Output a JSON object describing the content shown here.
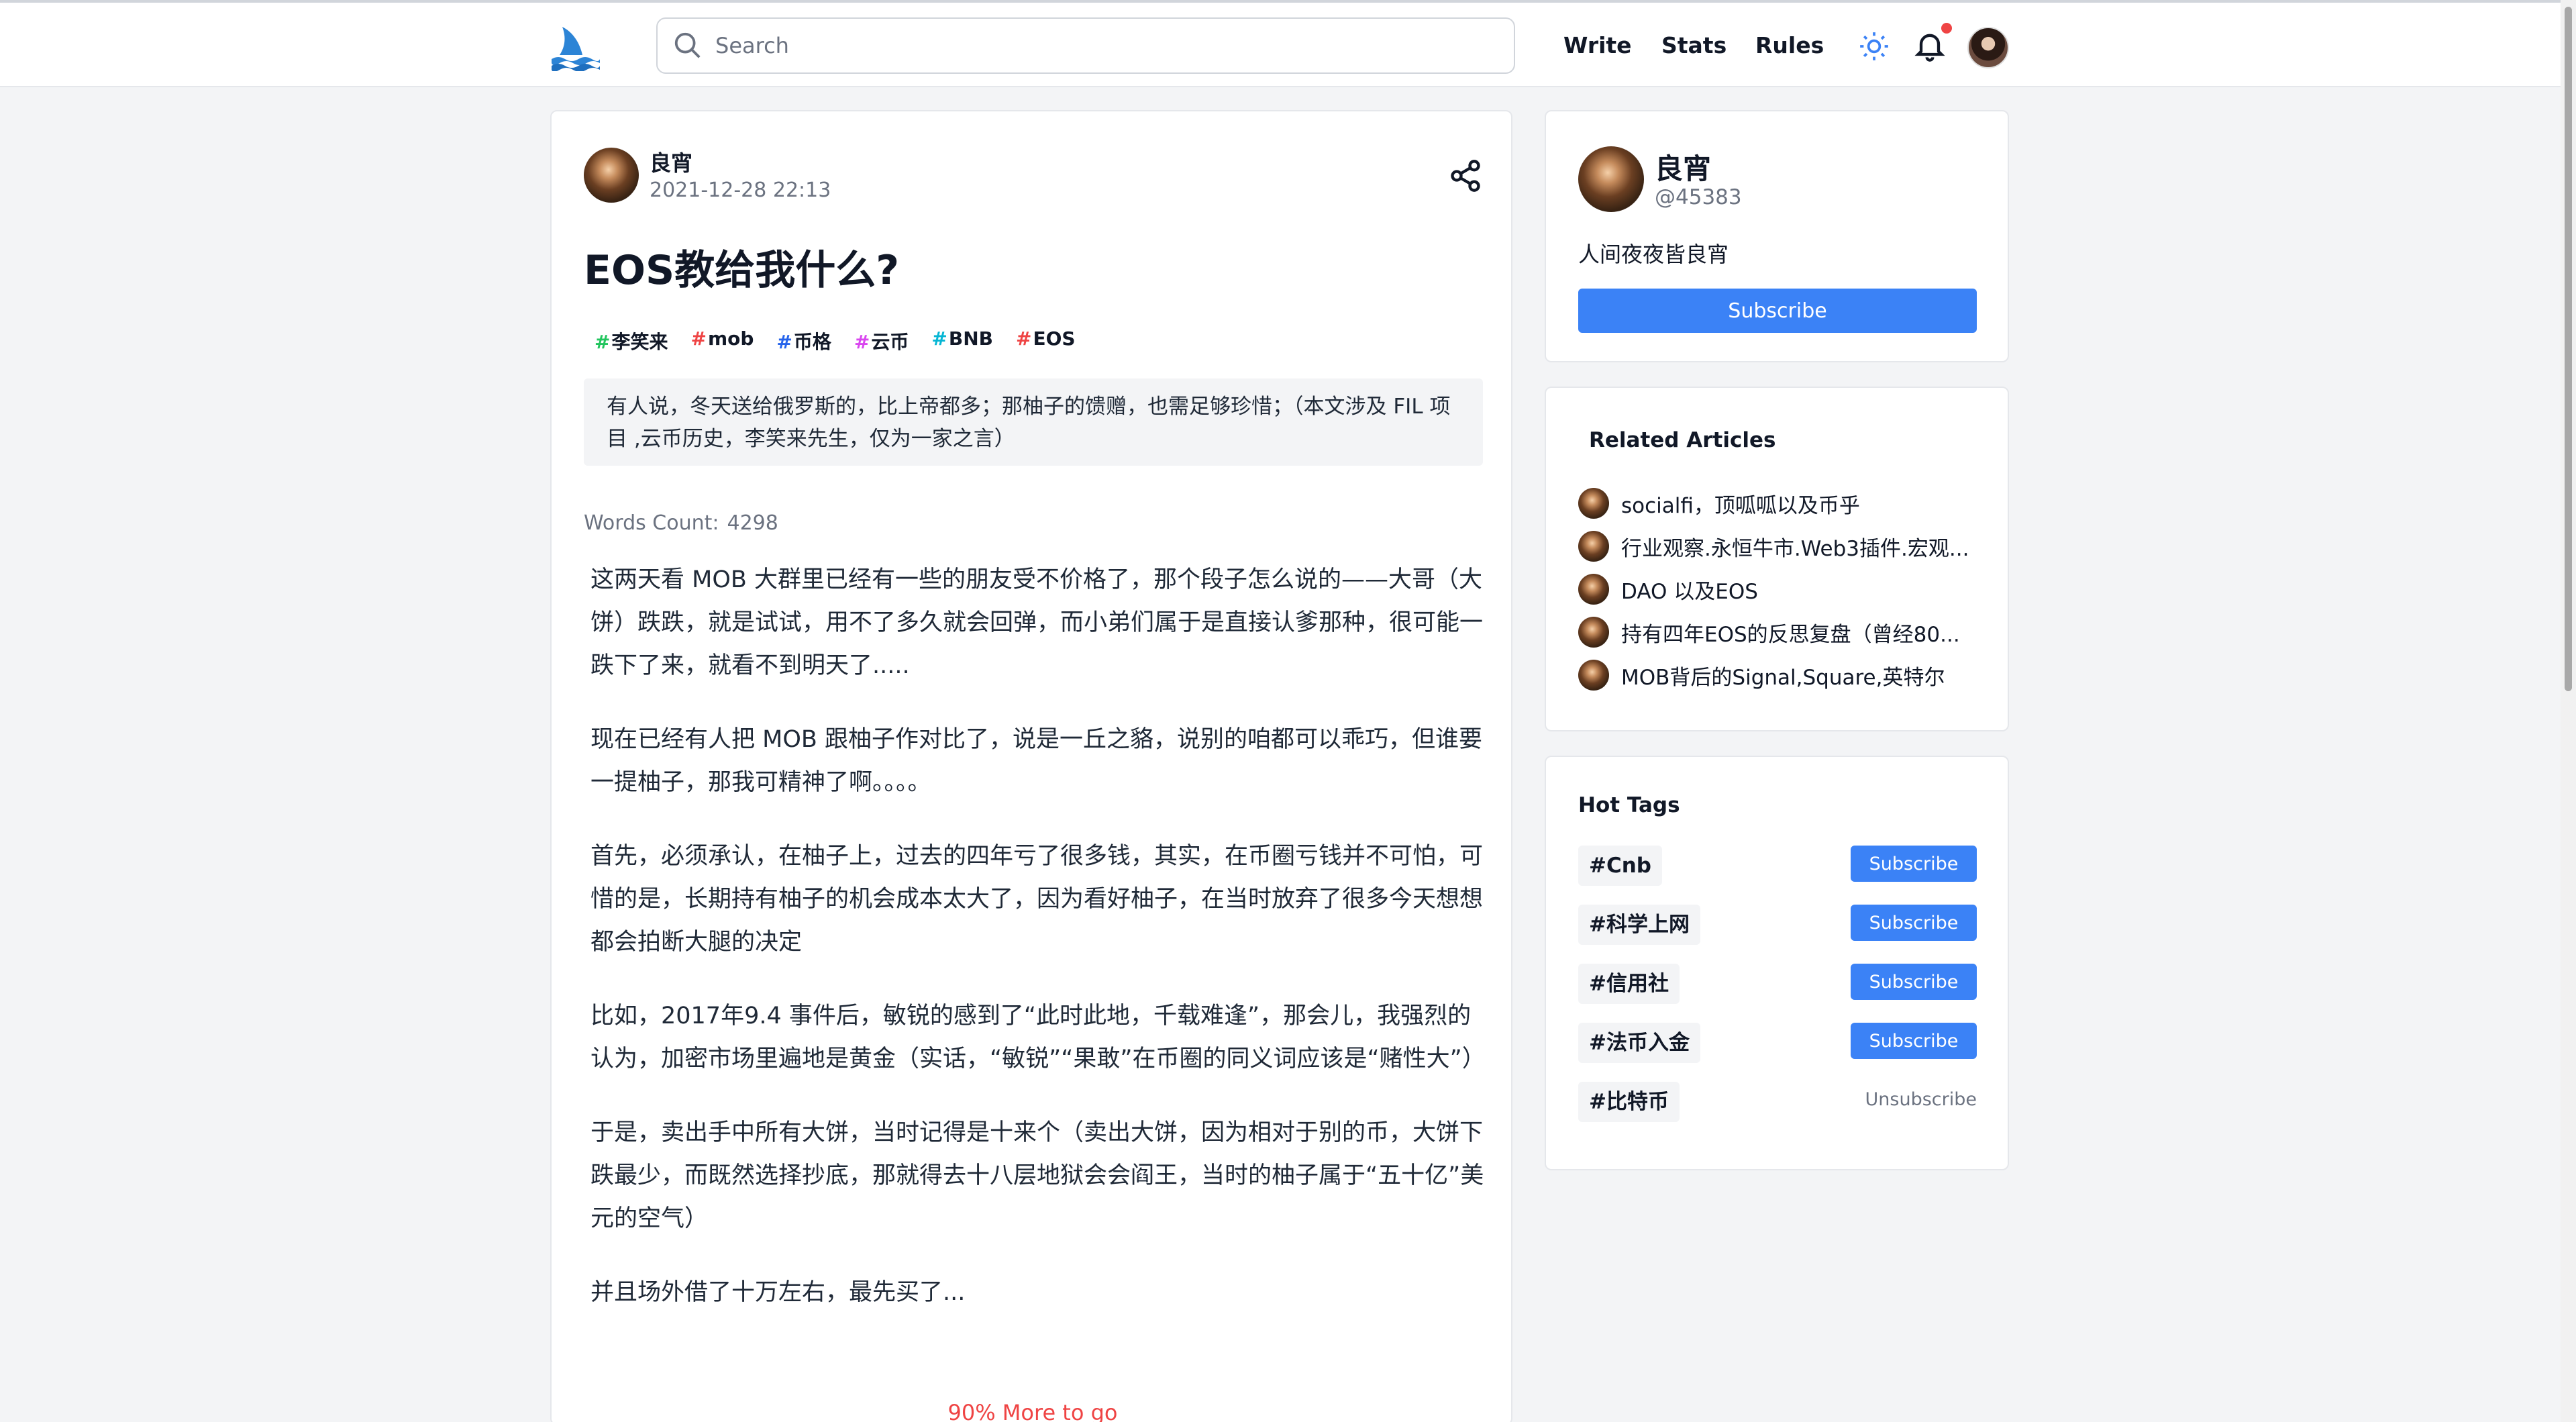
{
  "header": {
    "search_placeholder": "Search",
    "nav": [
      "Write",
      "Stats",
      "Rules"
    ],
    "icons": {
      "logo": "shark-fin-logo",
      "search": "search-icon",
      "theme": "sun-icon",
      "notification": "bell-icon"
    },
    "colors": {
      "accent": "#3b82f6",
      "notification_dot": "#ef4444"
    }
  },
  "article": {
    "author": "良宵",
    "date": "2021-12-28 22:13",
    "title": "EOS教给我什么?",
    "tags": [
      {
        "label": "李笑来",
        "hash_color": "#22c55e"
      },
      {
        "label": "mob",
        "hash_color": "#ef4444"
      },
      {
        "label": "币格",
        "hash_color": "#2563eb"
      },
      {
        "label": "云币",
        "hash_color": "#d946ef"
      },
      {
        "label": "BNB",
        "hash_color": "#06b6d4"
      },
      {
        "label": "EOS",
        "hash_color": "#ef4444"
      }
    ],
    "summary": "有人说，冬天送给俄罗斯的，比上帝都多；那柚子的馈赠，也需足够珍惜；（本文涉及 FIL 项目 ,云币历史，李笑来先生，仅为一家之言）",
    "words_label": "Words Count:",
    "words_count": "4298",
    "paragraphs": [
      "这两天看 MOB 大群里已经有一些的朋友受不价格了，那个段子怎么说的——大哥（大饼）跌跌，就是试试，用不了多久就会回弹，而小弟们属于是直接认爹那种，很可能一跌下了来，就看不到明天了.....",
      "现在已经有人把 MOB 跟柚子作对比了，说是一丘之貉，说别的咱都可以乖巧，但谁要一提柚子，那我可精神了啊。。。。",
      "首先，必须承认，在柚子上，过去的四年亏了很多钱，其实，在币圈亏钱并不可怕，可惜的是，长期持有柚子的机会成本太大了，因为看好柚子，在当时放弃了很多今天想想都会拍断大腿的决定",
      "比如，2017年9.4 事件后，敏锐的感到了“此时此地，千载难逢”，那会儿，我强烈的认为，加密市场里遍地是黄金（实话，“敏锐”“果敢”在币圈的同义词应该是“赌性大”）",
      "于是，卖出手中所有大饼，当时记得是十来个（卖出大饼，因为相对于别的币，大饼下跌最少，而既然选择抄底，那就得去十八层地狱会会阎王，当时的柚子属于“五十亿”美元的空气）",
      "并且场外借了十万左右，最先买了..."
    ],
    "more": "90% More to go"
  },
  "profile": {
    "name": "良宵",
    "handle": "@45383",
    "bio": "人间夜夜皆良宵",
    "subscribe": "Subscribe"
  },
  "related": {
    "title": "Related Articles",
    "items": [
      "socialfi，顶呱呱以及币乎",
      "行业观察.永恒牛市.Web3插件.宏观...",
      "DAO 以及EOS",
      "持有四年EOS的反思复盘（曾经80...",
      "MOB背后的Signal,Square,英特尔"
    ]
  },
  "hot_tags": {
    "title": "Hot Tags",
    "items": [
      {
        "tag": "#Cnb",
        "action": "Subscribe",
        "subscribed": false
      },
      {
        "tag": "#科学上网",
        "action": "Subscribe",
        "subscribed": false
      },
      {
        "tag": "#信用社",
        "action": "Subscribe",
        "subscribed": false
      },
      {
        "tag": "#法币入金",
        "action": "Subscribe",
        "subscribed": false
      },
      {
        "tag": "#比特币",
        "action": "Unsubscribe",
        "subscribed": true
      }
    ]
  }
}
